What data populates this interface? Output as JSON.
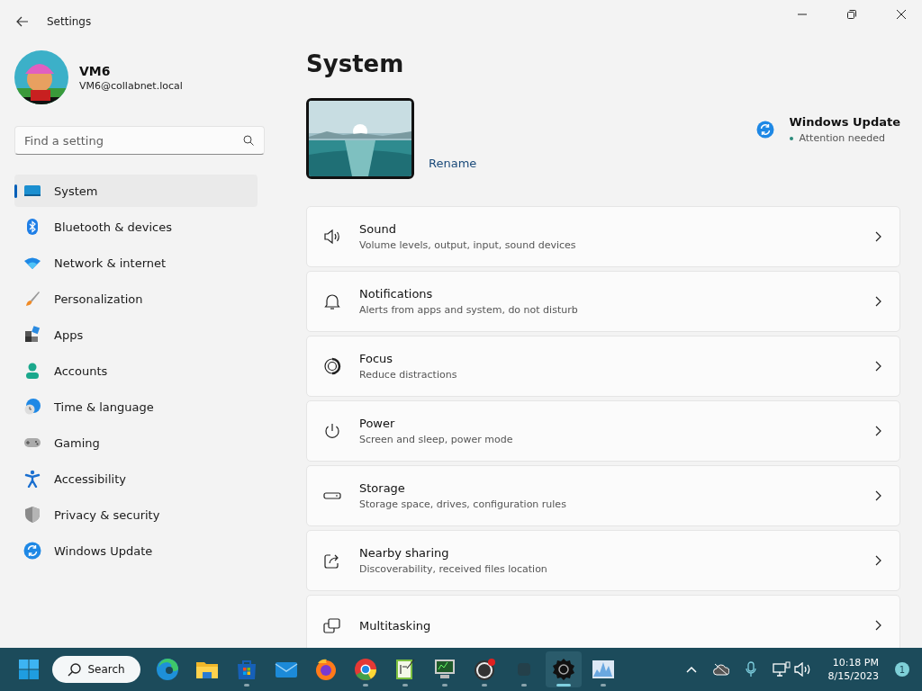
{
  "window": {
    "title": "Settings"
  },
  "user": {
    "name": "VM6",
    "email": "VM6@collabnet.local"
  },
  "search": {
    "placeholder": "Find a setting"
  },
  "nav": [
    {
      "kind": "system",
      "label": "System",
      "selected": true
    },
    {
      "kind": "bluetooth",
      "label": "Bluetooth & devices",
      "selected": false
    },
    {
      "kind": "network",
      "label": "Network & internet",
      "selected": false
    },
    {
      "kind": "brush",
      "label": "Personalization",
      "selected": false
    },
    {
      "kind": "apps",
      "label": "Apps",
      "selected": false
    },
    {
      "kind": "person",
      "label": "Accounts",
      "selected": false
    },
    {
      "kind": "clock",
      "label": "Time & language",
      "selected": false
    },
    {
      "kind": "gamepad",
      "label": "Gaming",
      "selected": false
    },
    {
      "kind": "accessibility",
      "label": "Accessibility",
      "selected": false
    },
    {
      "kind": "shield",
      "label": "Privacy & security",
      "selected": false
    },
    {
      "kind": "update",
      "label": "Windows Update",
      "selected": false
    }
  ],
  "page": {
    "title": "System",
    "rename": "Rename",
    "update": {
      "title": "Windows Update",
      "status": "Attention needed"
    }
  },
  "settings": [
    {
      "kind": "sound",
      "title": "Sound",
      "description": "Volume levels, output, input, sound devices"
    },
    {
      "kind": "bell",
      "title": "Notifications",
      "description": "Alerts from apps and system, do not disturb"
    },
    {
      "kind": "focus",
      "title": "Focus",
      "description": "Reduce distractions"
    },
    {
      "kind": "power",
      "title": "Power",
      "description": "Screen and sleep, power mode"
    },
    {
      "kind": "storage",
      "title": "Storage",
      "description": "Storage space, drives, configuration rules"
    },
    {
      "kind": "share",
      "title": "Nearby sharing",
      "description": "Discoverability, received files location"
    },
    {
      "kind": "windows",
      "title": "Multitasking"
    }
  ],
  "taskbar": {
    "search": "Search",
    "apps": [
      {
        "kind": "edge",
        "running": false,
        "selected": false
      },
      {
        "kind": "folder",
        "running": false,
        "selected": false
      },
      {
        "kind": "store",
        "running": true,
        "selected": false
      },
      {
        "kind": "mail",
        "running": false,
        "selected": false
      },
      {
        "kind": "firefox",
        "running": false,
        "selected": false
      },
      {
        "kind": "chrome",
        "running": true,
        "selected": false
      },
      {
        "kind": "notepad",
        "running": true,
        "selected": false
      },
      {
        "kind": "monitor",
        "running": true,
        "selected": false
      },
      {
        "kind": "obs",
        "running": true,
        "selected": false
      },
      {
        "kind": "blank",
        "running": true,
        "selected": false
      },
      {
        "kind": "gear",
        "running": true,
        "selected": true
      },
      {
        "kind": "chart",
        "running": true,
        "selected": false
      }
    ],
    "time": "10:18 PM",
    "date": "8/15/2023",
    "notifications": "1"
  }
}
